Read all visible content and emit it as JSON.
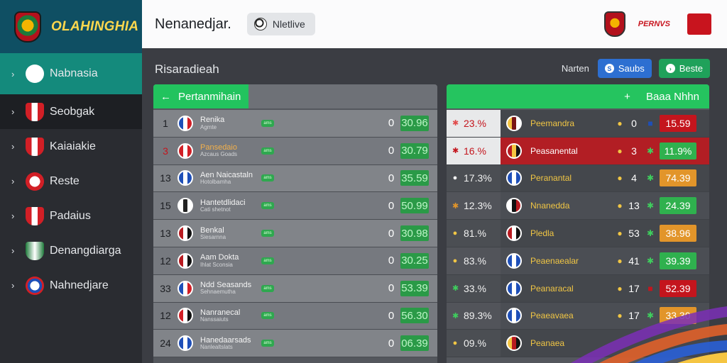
{
  "app": {
    "brand_name": "OLAHINGHIA",
    "top_title": "Nenanedjar.",
    "top_chip": "Nletlive",
    "top_brand": "PERNVS"
  },
  "sidebar": {
    "items": [
      {
        "label": "Nabnasia",
        "icon": "soccer-ball-icon",
        "active": true
      },
      {
        "label": "Seobgak",
        "icon": "shield-icon",
        "dark": true
      },
      {
        "label": "Kaiaiakie",
        "icon": "striped-crest-icon"
      },
      {
        "label": "Reste",
        "icon": "fox-crest-icon"
      },
      {
        "label": "Padaius",
        "icon": "red-crest-icon"
      },
      {
        "label": "Denangdiarga",
        "icon": "green-crest-icon"
      },
      {
        "label": "Nahnedjare",
        "icon": "round-crest-icon"
      }
    ]
  },
  "main": {
    "section_title": "Risaradieah",
    "actions": {
      "label": "Narten",
      "btn_blue": "Saubs",
      "btn_green": "Beste"
    },
    "left_panel": {
      "tab_label": "Pertanmihain",
      "rows": [
        {
          "rank": "1",
          "name": "Renika",
          "sub": "Agmte",
          "pill": "ams",
          "zero": "0",
          "score": "30.96",
          "flag": [
            "#1e4fb8",
            "#ffffff",
            "#d21f26"
          ]
        },
        {
          "rank": "3",
          "name": "Pansedaio",
          "sub": "Azcaus Goads",
          "pill": "ams",
          "zero": "0",
          "score": "30.79",
          "flag": [
            "#d21f26",
            "#ffffff",
            "#d21f26"
          ],
          "hl": true
        },
        {
          "rank": "13",
          "name": "Aen Naicastaln",
          "sub": "Hotolbamha",
          "pill": "ams",
          "zero": "0",
          "score": "35.59",
          "flag": [
            "#1e4fb8",
            "#ffffff",
            "#1e4fb8"
          ]
        },
        {
          "rank": "15",
          "name": "Hantetdlidaci",
          "sub": "Cati shetnot",
          "pill": "ams",
          "zero": "0",
          "score": "50.99",
          "flag": [
            "#ffffff",
            "#222222",
            "#ffffff"
          ]
        },
        {
          "rank": "13",
          "name": "Benkal",
          "sub": "Siesarnna",
          "pill": "ams",
          "zero": "0",
          "score": "30.98",
          "flag": [
            "#b81a20",
            "#ffffff",
            "#111111"
          ]
        },
        {
          "rank": "12",
          "name": "Aam Dokta",
          "sub": "Ihlat Sconsia",
          "pill": "ams",
          "zero": "0",
          "score": "30.25",
          "flag": [
            "#b81a20",
            "#ffffff",
            "#111111"
          ]
        },
        {
          "rank": "33",
          "name": "Ndd Seasands",
          "sub": "Sehnaemutha",
          "pill": "ams",
          "zero": "0",
          "score": "53.39",
          "flag": [
            "#1e4fb8",
            "#ffffff",
            "#d21f26"
          ]
        },
        {
          "rank": "12",
          "name": "Nanranecal",
          "sub": "Nanssaiuts",
          "pill": "ams",
          "zero": "0",
          "score": "56.30",
          "flag": [
            "#d21f26",
            "#ffffff",
            "#111111"
          ]
        },
        {
          "rank": "24",
          "name": "Hanedaarsads",
          "sub": "Nanlealtslats",
          "pill": "ams",
          "zero": "0",
          "score": "06.39",
          "flag": [
            "#1e4fb8",
            "#ffffff",
            "#1e4fb8"
          ]
        }
      ]
    },
    "right_panel": {
      "head_plus": "+",
      "head_label": "Baaa Nhhn",
      "rows": [
        {
          "pct": "23.%",
          "sym": "✱",
          "symColor": "#e14b4b",
          "name": "Peemandra",
          "dot": "●",
          "num": "0",
          "rsym": "■",
          "rsymColor": "#1e4fb8",
          "score": "15.59",
          "scoreColor": "#c4151d",
          "style": "plain",
          "flag": [
            "#f5c542",
            "#7a1515",
            "#ffffff"
          ]
        },
        {
          "pct": "16.%",
          "sym": "✱",
          "symColor": "#c4151d",
          "name": "Peasanental",
          "dot": "●",
          "num": "3",
          "rsym": "✱",
          "rsymColor": "#3ecf5d",
          "score": "11.9%",
          "scoreColor": "#2fb14e",
          "style": "hot",
          "flag": [
            "#b81a20",
            "#f5c542",
            "#111111"
          ]
        },
        {
          "pct": "17.3%",
          "sym": "●",
          "symColor": "#f1f1f1",
          "name": "Peranantal",
          "dot": "●",
          "num": "4",
          "rsym": "✱",
          "rsymColor": "#3ecf5d",
          "score": "74.39",
          "scoreColor": "#e2952a",
          "style": "plain",
          "flag": [
            "#1e4fb8",
            "#ffffff",
            "#1e4fb8"
          ]
        },
        {
          "pct": "12.3%",
          "sym": "✱",
          "symColor": "#e1952a",
          "name": "Nnanedda",
          "dot": "●",
          "num": "13",
          "rsym": "✱",
          "rsymColor": "#3ecf5d",
          "score": "24.39",
          "scoreColor": "#2fb14e",
          "style": "plain",
          "flag": [
            "#ffffff",
            "#111111",
            "#b81a20"
          ]
        },
        {
          "pct": "81.%",
          "sym": "●",
          "symColor": "#f1c644",
          "name": "Pledla",
          "dot": "●",
          "num": "53",
          "rsym": "✱",
          "rsymColor": "#3ecf5d",
          "score": "38.96",
          "scoreColor": "#e2952a",
          "style": "plain",
          "flag": [
            "#b81a20",
            "#ffffff",
            "#111111"
          ]
        },
        {
          "pct": "83.%",
          "sym": "●",
          "symColor": "#f1c644",
          "name": "Peaenaealar",
          "dot": "●",
          "num": "41",
          "rsym": "✱",
          "rsymColor": "#3ecf5d",
          "score": "39.39",
          "scoreColor": "#2fb14e",
          "style": "plain",
          "flag": [
            "#1e4fb8",
            "#ffffff",
            "#1e4fb8"
          ]
        },
        {
          "pct": "33.%",
          "sym": "✱",
          "symColor": "#3ecf5d",
          "name": "Peanaracal",
          "dot": "●",
          "num": "17",
          "rsym": "■",
          "rsymColor": "#c4151d",
          "score": "52.39",
          "scoreColor": "#c4151d",
          "style": "plain",
          "flag": [
            "#1e4fb8",
            "#ffffff",
            "#1e4fb8"
          ]
        },
        {
          "pct": "89.3%",
          "sym": "✱",
          "symColor": "#3ecf5d",
          "name": "Peaeavaea",
          "dot": "●",
          "num": "17",
          "rsym": "✱",
          "rsymColor": "#3ecf5d",
          "score": "33.30",
          "scoreColor": "#e2952a",
          "style": "plain",
          "flag": [
            "#1e4fb8",
            "#ffffff",
            "#1e4fb8"
          ]
        },
        {
          "pct": "09.%",
          "sym": "●",
          "symColor": "#f1c644",
          "name": "Peanaea",
          "dot": "",
          "num": "",
          "rsym": "",
          "rsymColor": "#3ecf5d",
          "score": "",
          "scoreColor": "transparent",
          "style": "plain",
          "flag": [
            "#f5c542",
            "#b81a20",
            "#111111"
          ]
        }
      ]
    }
  }
}
